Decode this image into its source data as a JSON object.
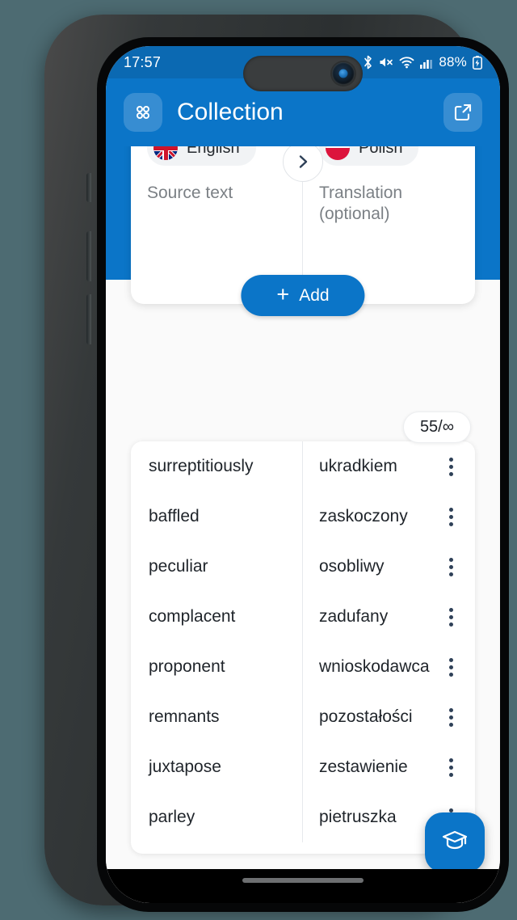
{
  "status_bar": {
    "time": "17:57",
    "battery_percent": "88%",
    "icons": [
      "bluetooth-icon",
      "mute-icon",
      "wifi-icon",
      "cellular-signal-icon",
      "battery-charging-icon"
    ]
  },
  "app_bar": {
    "menu_icon": "grid-dots-icon",
    "title": "Collection",
    "share_icon": "share-external-icon"
  },
  "input_card": {
    "source": {
      "flag": "uk-flag-icon",
      "language": "English",
      "placeholder": "Source text",
      "value": ""
    },
    "target": {
      "flag": "poland-flag-icon",
      "language": "Polish",
      "placeholder": "Translation (optional)",
      "value": ""
    },
    "swap_icon": "chevron-right-icon",
    "help_label": "?"
  },
  "add_button": {
    "plus": "+",
    "label": "Add"
  },
  "counter": {
    "label": "55/∞"
  },
  "entries": [
    {
      "source": "surreptitiously",
      "target": "ukradkiem"
    },
    {
      "source": "baffled",
      "target": "zaskoczony"
    },
    {
      "source": "peculiar",
      "target": "osobliwy"
    },
    {
      "source": "complacent",
      "target": "zadufany"
    },
    {
      "source": "proponent",
      "target": "wnioskodawca"
    },
    {
      "source": "remnants",
      "target": "pozostałości"
    },
    {
      "source": "juxtapose",
      "target": "zestawienie"
    },
    {
      "source": "parley",
      "target": "pietruszka"
    }
  ],
  "fab": {
    "icon": "graduation-cap-icon"
  },
  "colors": {
    "primary_blue": "#0b75c8",
    "status_bar_blue": "#0b69b2",
    "page_background": "#4d6b72",
    "content_background": "#fafafa",
    "menu_dot": "#2e4057",
    "placeholder_text": "#7b8085"
  }
}
